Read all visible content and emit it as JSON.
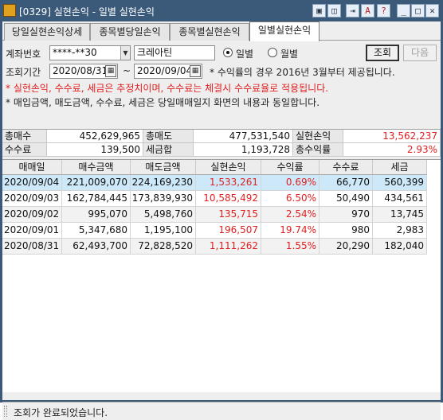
{
  "window": {
    "title": "[0329] 실현손익 - 일별 실현손익",
    "buttons": [
      {
        "name": "restore-layout-icon",
        "glyph": "▣"
      },
      {
        "name": "window-icon",
        "glyph": "◫"
      },
      {
        "name": "pin-icon",
        "glyph": "⇥"
      },
      {
        "name": "font-icon",
        "glyph": "A"
      },
      {
        "name": "help-icon",
        "glyph": "?"
      },
      {
        "name": "minimize-icon",
        "glyph": "_"
      },
      {
        "name": "maximize-icon",
        "glyph": "□"
      },
      {
        "name": "close-icon",
        "glyph": "✕"
      }
    ],
    "title_bar_color": "#3b5a7a"
  },
  "tabs": [
    {
      "label": "당일실현손익상세",
      "active": false
    },
    {
      "label": "종목별당일손익",
      "active": false
    },
    {
      "label": "종목별실현손익",
      "active": false
    },
    {
      "label": "일별실현손익",
      "active": true
    }
  ],
  "form": {
    "account_label": "계좌번호",
    "account_value": "****-**30",
    "account_name": "크레아틴",
    "period_label": "조회기간",
    "start_date": "2020/08/31",
    "end_date": "2020/09/04",
    "period_sep": "~",
    "radio_daily": "일별",
    "radio_monthly": "월별",
    "daily_selected": true,
    "query_button": "조회",
    "next_button": "다음",
    "notice_1": "* 수익률의 경우 2016년 3월부터 제공됩니다.",
    "notice_2": "* 실현손익, 수수료, 세금은 추정치이며, 수수료는 체결시 수수료율로 적용됩니다.",
    "notice_3": "* 매입금액, 매도금액, 수수료, 세금은 당일매매일지 화면의 내용과 동일합니다."
  },
  "summary": {
    "total_buy_label": "총매수",
    "total_buy": "452,629,965",
    "total_sell_label": "총매도",
    "total_sell": "477,531,540",
    "realized_label": "실현손익",
    "realized": "13,562,237",
    "fee_label": "수수료",
    "fee": "139,500",
    "tax_label": "세금합",
    "tax": "1,193,728",
    "return_label": "총수익률",
    "return": "2.93%"
  },
  "table": {
    "headers": [
      "매매일",
      "매수금액",
      "매도금액",
      "실현손익",
      "수익률",
      "수수료",
      "세금"
    ],
    "rows": [
      [
        "2020/09/04",
        "221,009,070",
        "224,169,230",
        "1,533,261",
        "0.69%",
        "66,770",
        "560,399"
      ],
      [
        "2020/09/03",
        "162,784,445",
        "173,839,930",
        "10,585,492",
        "6.50%",
        "50,490",
        "434,561"
      ],
      [
        "2020/09/02",
        "995,070",
        "5,498,760",
        "135,715",
        "2.54%",
        "970",
        "13,745"
      ],
      [
        "2020/09/01",
        "5,347,680",
        "1,195,100",
        "196,507",
        "19.74%",
        "980",
        "2,983"
      ],
      [
        "2020/08/31",
        "62,493,700",
        "72,828,520",
        "1,111,262",
        "1.55%",
        "20,290",
        "182,040"
      ]
    ]
  },
  "status": {
    "text": "조회가 완료되었습니다."
  },
  "colors": {
    "positive": "#e02020",
    "selected_row": "#cde8f8",
    "alt_row": "#f2f2f2"
  }
}
